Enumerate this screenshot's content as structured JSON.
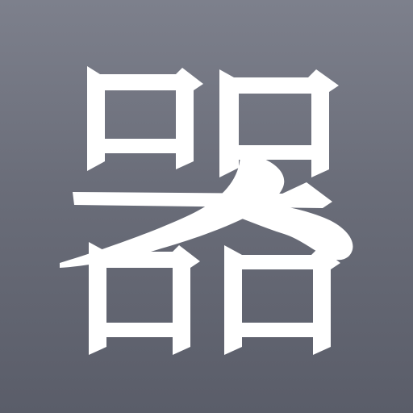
{
  "app_icon": {
    "glyph_char": "器",
    "icon_name": "ideograph-qi-icon",
    "colors": {
      "background_top": "#7d808c",
      "background_bottom": "#5a5d69",
      "glyph": "#ffffff"
    }
  }
}
